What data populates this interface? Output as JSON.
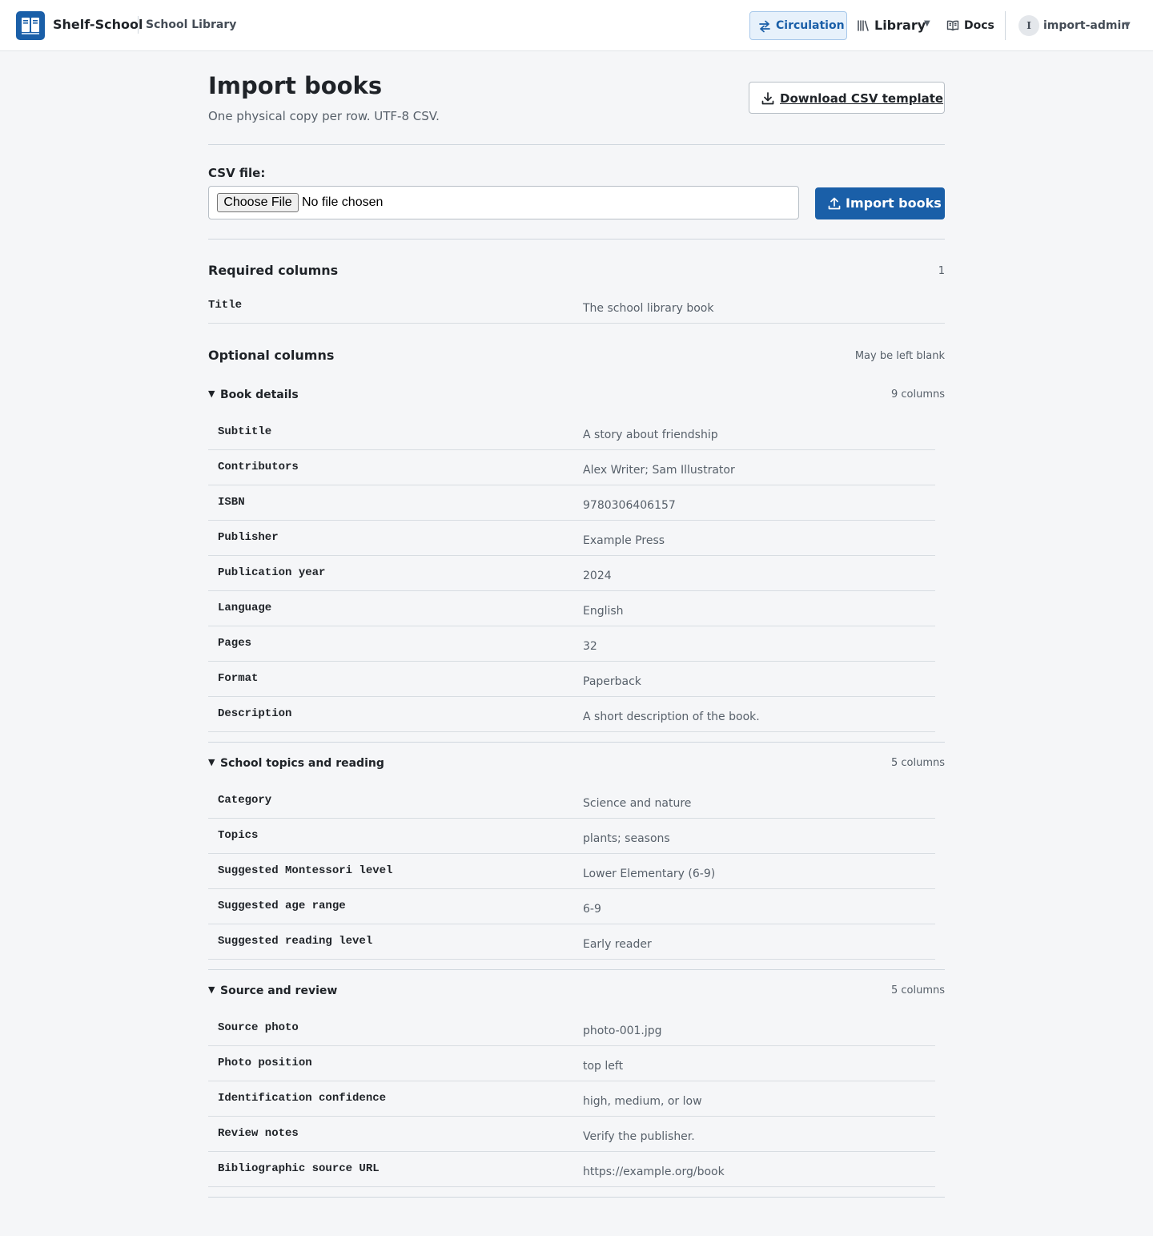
{
  "header": {
    "brand": "Shelf-School",
    "subtitle": "School Library",
    "nav": {
      "circulation": "Circulation",
      "library": "Library",
      "docs": "Docs"
    },
    "user": {
      "initial": "I",
      "name": "import-admin"
    },
    "accent_color": "#1a5fa8"
  },
  "page": {
    "title": "Import books",
    "lede": "One physical copy per row. UTF-8 CSV.",
    "download_label": "Download CSV template"
  },
  "upload": {
    "label": "CSV file:",
    "choose_label": "Choose File",
    "no_file": "No file chosen",
    "import_label": "Import books"
  },
  "required": {
    "title": "Required columns",
    "count": "1",
    "rows": [
      {
        "name": "Title",
        "example": "The school library book"
      }
    ]
  },
  "optional": {
    "title": "Optional columns",
    "note": "May be left blank",
    "groups": [
      {
        "title": "Book details",
        "count": "9 columns",
        "rows": [
          {
            "name": "Subtitle",
            "example": "A story about friendship"
          },
          {
            "name": "Contributors",
            "example": "Alex Writer; Sam Illustrator"
          },
          {
            "name": "ISBN",
            "example": "9780306406157"
          },
          {
            "name": "Publisher",
            "example": "Example Press"
          },
          {
            "name": "Publication year",
            "example": "2024"
          },
          {
            "name": "Language",
            "example": "English"
          },
          {
            "name": "Pages",
            "example": "32"
          },
          {
            "name": "Format",
            "example": "Paperback"
          },
          {
            "name": "Description",
            "example": "A short description of the book."
          }
        ]
      },
      {
        "title": "School topics and reading",
        "count": "5 columns",
        "rows": [
          {
            "name": "Category",
            "example": "Science and nature"
          },
          {
            "name": "Topics",
            "example": "plants; seasons"
          },
          {
            "name": "Suggested Montessori level",
            "example": "Lower Elementary (6-9)"
          },
          {
            "name": "Suggested age range",
            "example": "6-9"
          },
          {
            "name": "Suggested reading level",
            "example": "Early reader"
          }
        ]
      },
      {
        "title": "Source and review",
        "count": "5 columns",
        "rows": [
          {
            "name": "Source photo",
            "example": "photo-001.jpg"
          },
          {
            "name": "Photo position",
            "example": "top left"
          },
          {
            "name": "Identification confidence",
            "example": "high, medium, or low"
          },
          {
            "name": "Review notes",
            "example": "Verify the publisher."
          },
          {
            "name": "Bibliographic source URL",
            "example": "https://example.org/book"
          }
        ]
      }
    ]
  }
}
